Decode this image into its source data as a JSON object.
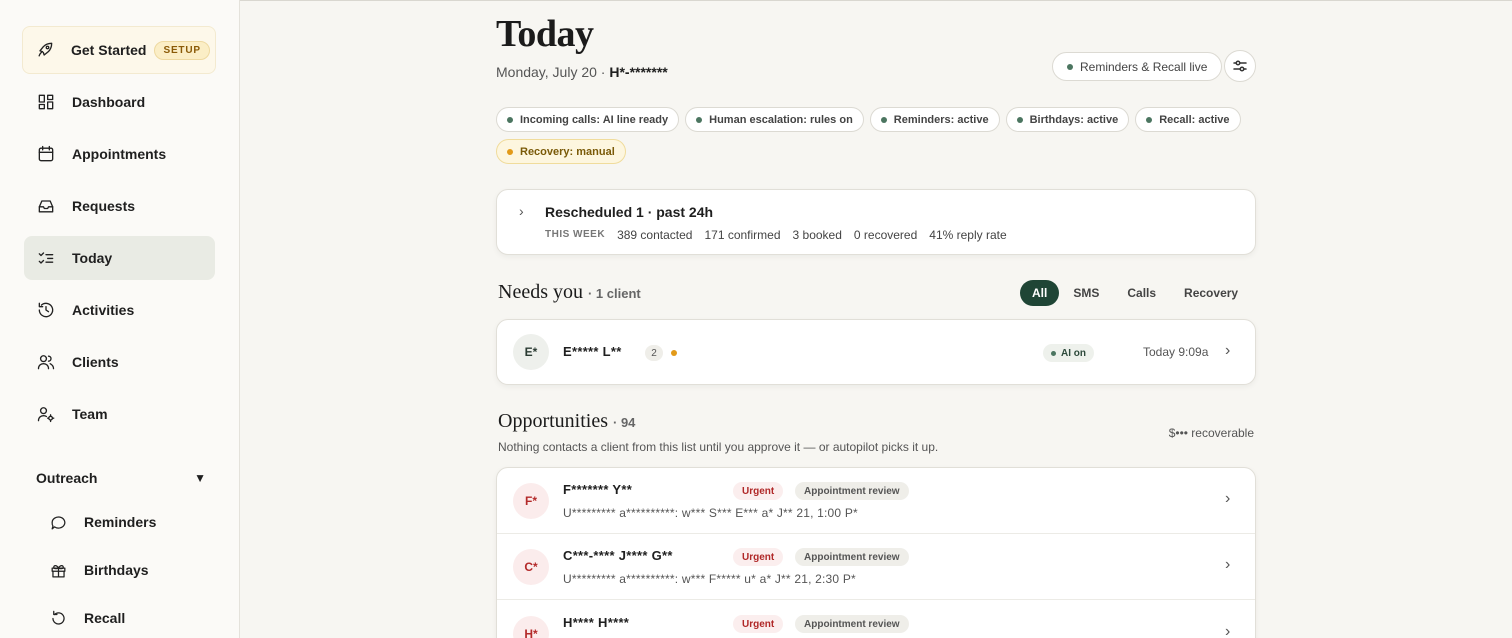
{
  "sidebar": {
    "get_started": {
      "label": "Get Started",
      "badge": "SETUP"
    },
    "items": [
      {
        "label": "Dashboard",
        "icon": "dashboard-icon"
      },
      {
        "label": "Appointments",
        "icon": "calendar-icon"
      },
      {
        "label": "Requests",
        "icon": "inbox-icon"
      },
      {
        "label": "Today",
        "icon": "checklist-icon",
        "active": true
      },
      {
        "label": "Activities",
        "icon": "history-icon"
      },
      {
        "label": "Clients",
        "icon": "users-icon"
      },
      {
        "label": "Team",
        "icon": "user-gear-icon"
      }
    ],
    "outreach": {
      "label": "Outreach",
      "caret": "▼",
      "items": [
        {
          "label": "Reminders",
          "icon": "chat-bubble-icon"
        },
        {
          "label": "Birthdays",
          "icon": "gift-icon"
        },
        {
          "label": "Recall",
          "icon": "rotate-icon"
        }
      ]
    }
  },
  "header": {
    "title": "Today",
    "date": "Monday, July 20",
    "separator": "·",
    "practice": "H*-*******",
    "live_label": "Reminders & Recall live"
  },
  "statuses": [
    {
      "label": "Incoming calls: AI line ready",
      "tone": "ok"
    },
    {
      "label": "Human escalation: rules on",
      "tone": "ok"
    },
    {
      "label": "Reminders: active",
      "tone": "ok"
    },
    {
      "label": "Birthdays: active",
      "tone": "ok"
    },
    {
      "label": "Recall: active",
      "tone": "ok"
    },
    {
      "label": "Recovery: manual",
      "tone": "warn"
    }
  ],
  "summary": {
    "chevron": "›",
    "title": "Rescheduled 1 · past 24h",
    "week_label": "THIS WEEK",
    "stats": [
      "389 contacted",
      "171 confirmed",
      "3 booked",
      "0 recovered",
      "41% reply rate"
    ]
  },
  "needs_you": {
    "title": "Needs you",
    "count": "· 1 client",
    "filters": [
      "All",
      "SMS",
      "Calls",
      "Recovery"
    ],
    "active_filter": "All",
    "client": {
      "initials": "E*",
      "name": "E***** L**",
      "count": "2",
      "ai_label": "AI on",
      "time": "Today 9:09a"
    }
  },
  "opportunities": {
    "title": "Opportunities",
    "count": "· 94",
    "description": "Nothing contacts a client from this list until you approve it — or autopilot picks it up.",
    "recoverable": "$••• recoverable",
    "rows": [
      {
        "initials": "F*",
        "name": "F******* Y**",
        "urgency": "Urgent",
        "type": "Appointment review",
        "detail": "U********* a**********: w*** S*** E*** a* J** 21, 1:00 P*"
      },
      {
        "initials": "C*",
        "name": "C***-**** J**** G**",
        "urgency": "Urgent",
        "type": "Appointment review",
        "detail": "U********* a**********: w*** F***** u* a* J** 21, 2:30 P*"
      },
      {
        "initials": "H*",
        "name": "H**** H****",
        "urgency": "Urgent",
        "type": "Appointment review",
        "detail": ""
      }
    ]
  },
  "colors": {
    "accent": "#1f4535",
    "status_dot": "#4b7560",
    "warning_dot": "#e29a19",
    "urgent": "#b02828"
  }
}
